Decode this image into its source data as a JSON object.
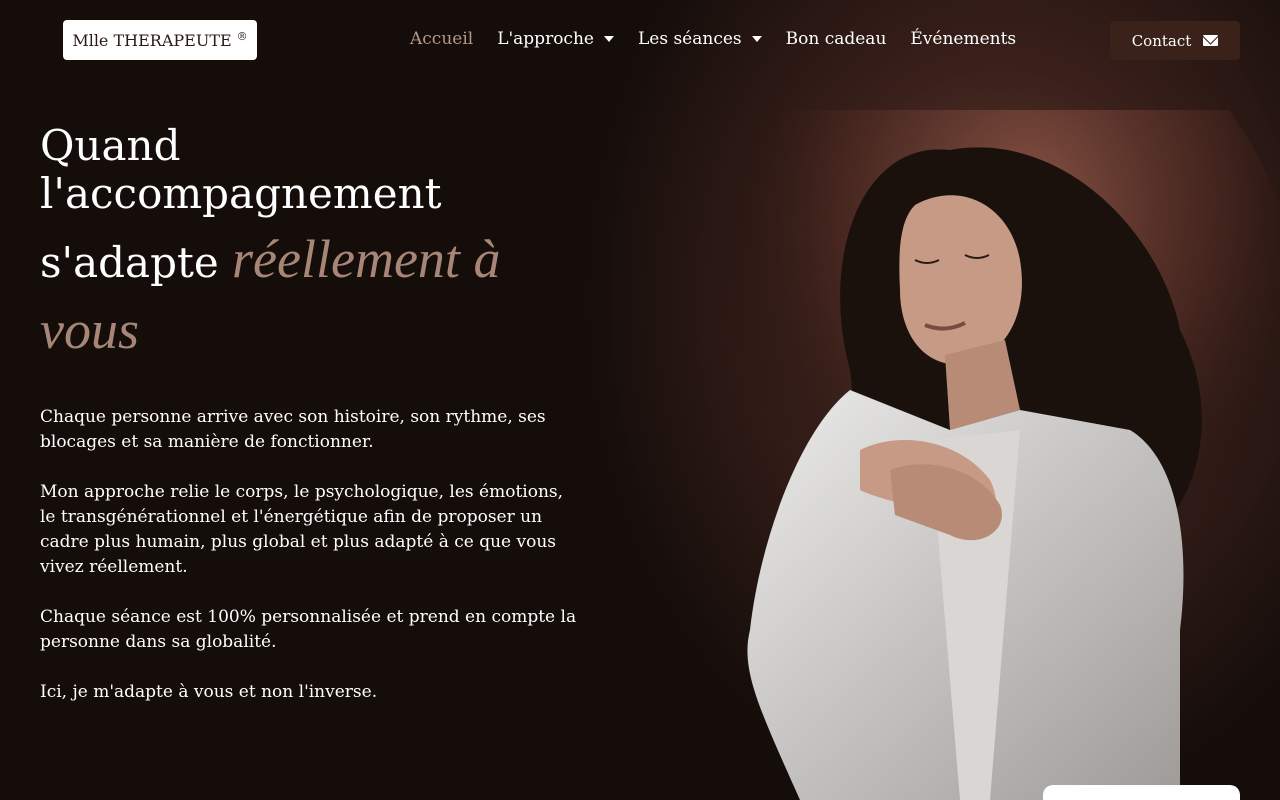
{
  "header": {
    "logo_text": "Mlle THERAPEUTE",
    "logo_mark": "®",
    "nav": [
      {
        "label": "Accueil",
        "active": true,
        "dropdown": false
      },
      {
        "label": "L'approche",
        "active": false,
        "dropdown": true
      },
      {
        "label": "Les séances",
        "active": false,
        "dropdown": true
      },
      {
        "label": "Bon cadeau",
        "active": false,
        "dropdown": false
      },
      {
        "label": "Événements",
        "active": false,
        "dropdown": false
      }
    ],
    "contact_label": "Contact",
    "contact_icon": "envelope-icon"
  },
  "hero": {
    "title_line1": "Quand l'accompagnement",
    "title_line2_plain": "s'adapte ",
    "title_line2_accent": "réellement à",
    "title_line3_accent": "vous",
    "paragraph1": "Chaque personne arrive avec son histoire, son rythme, ses blocages et sa manière de fonctionner.",
    "paragraph2": "Mon approche relie le corps, le psychologique, les émotions, le transgénérationnel et l'énergétique afin de proposer un cadre plus humain, plus global et plus adapté à ce que vous vivez réellement.",
    "paragraph3": "Chaque séance est 100% personnalisée et prend en compte la personne dans sa globalité.",
    "paragraph4": "Ici, je m'adapte à vous et non l'inverse."
  },
  "colors": {
    "background": "#140d0a",
    "accent": "#a78677",
    "nav_active": "#b59886",
    "button_bg": "#3a2119"
  }
}
